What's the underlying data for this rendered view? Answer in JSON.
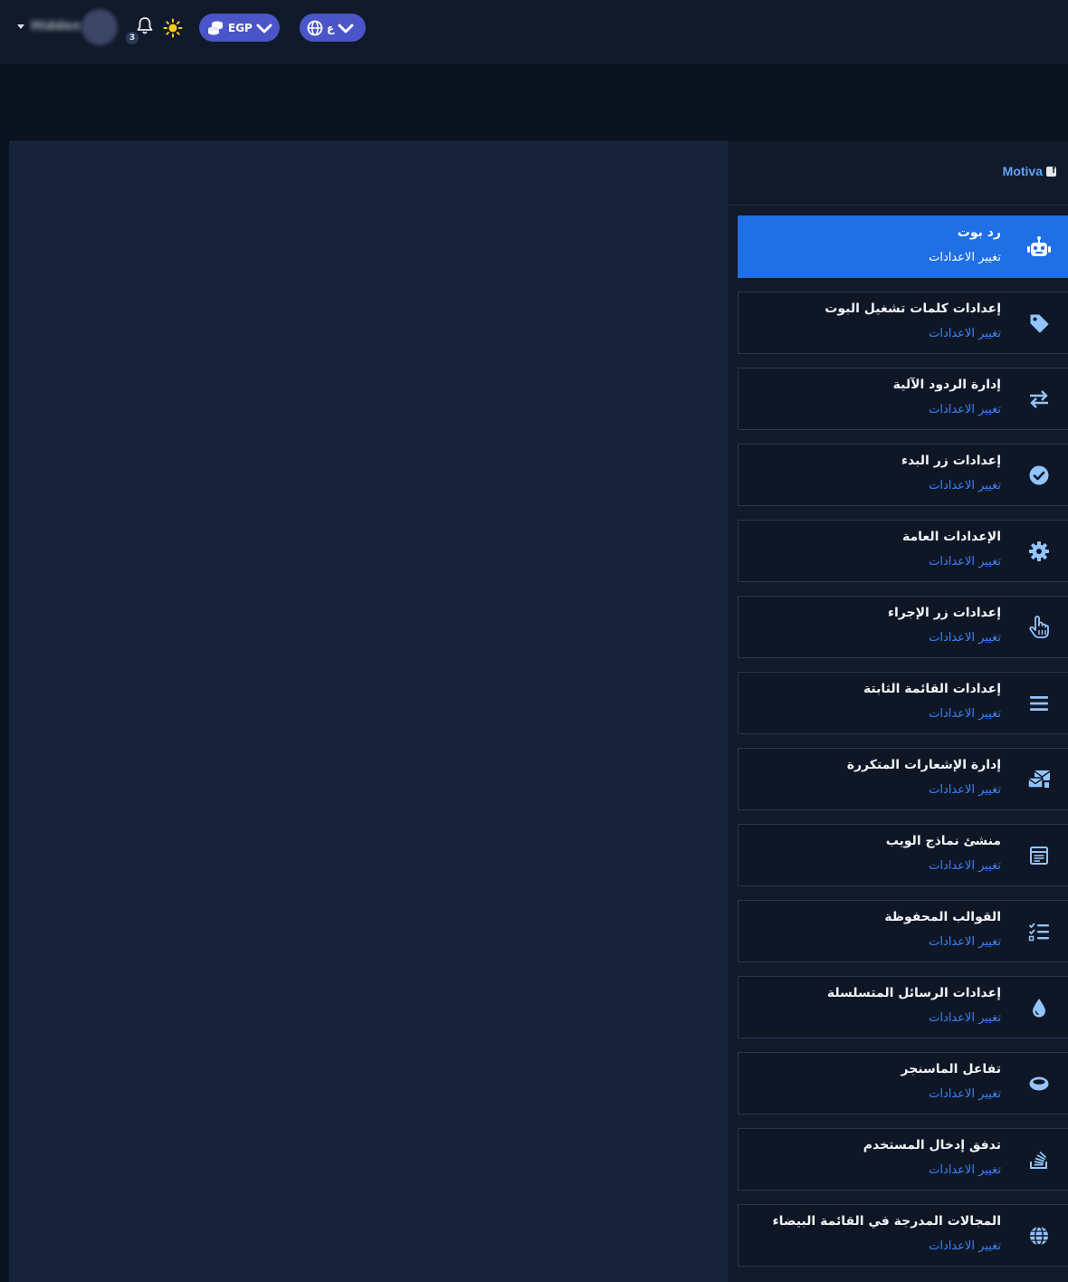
{
  "topbar": {
    "user_name": "Hidden",
    "notification_count": "3",
    "currency": "EGP",
    "language": "ع"
  },
  "sidebar": {
    "brand": "Motiva",
    "items": [
      {
        "title": "رد بوت",
        "subtitle": "تغيير الاعدادات",
        "icon": "robot-icon",
        "active": true
      },
      {
        "title": "إعدادات كلمات تشغيل البوت",
        "subtitle": "تغيير الاعدادات",
        "icon": "tag-icon",
        "active": false
      },
      {
        "title": "إدارة الردود الآلية",
        "subtitle": "تغيير الاعدادات",
        "icon": "arrows-exchange-icon",
        "active": false
      },
      {
        "title": "إعدادات زر البدء",
        "subtitle": "تغيير الاعدادات",
        "icon": "check-circle-icon",
        "active": false
      },
      {
        "title": "الإعدادات العامة",
        "subtitle": "تغيير الاعدادات",
        "icon": "gear-icon",
        "active": false
      },
      {
        "title": "إعدادات زر الإجراء",
        "subtitle": "تغيير الاعدادات",
        "icon": "hand-pointer-icon",
        "active": false
      },
      {
        "title": "إعدادات القائمة الثابتة",
        "subtitle": "تغيير الاعدادات",
        "icon": "bars-icon",
        "active": false
      },
      {
        "title": "إدارة الإشعارات المتكررة",
        "subtitle": "تغيير الاعدادات",
        "icon": "mail-bulk-icon",
        "active": false
      },
      {
        "title": "منشئ نماذج الويب",
        "subtitle": "تغيير الاعدادات",
        "icon": "form-icon",
        "active": false
      },
      {
        "title": "القوالب المحفوظة",
        "subtitle": "تغيير الاعدادات",
        "icon": "list-check-icon",
        "active": false
      },
      {
        "title": "إعدادات الرسائل المتسلسلة",
        "subtitle": "تغيير الاعدادات",
        "icon": "droplet-icon",
        "active": false
      },
      {
        "title": "تفاعل الماسنجر",
        "subtitle": "تغيير الاعدادات",
        "icon": "ring-icon",
        "active": false
      },
      {
        "title": "تدفق إدخال المستخدم",
        "subtitle": "تغيير الاعدادات",
        "icon": "stack-icon",
        "active": false
      },
      {
        "title": "المجالات المدرجة في القائمة البيضاء",
        "subtitle": "تغيير الاعدادات",
        "icon": "globe-icon",
        "active": false
      }
    ]
  }
}
